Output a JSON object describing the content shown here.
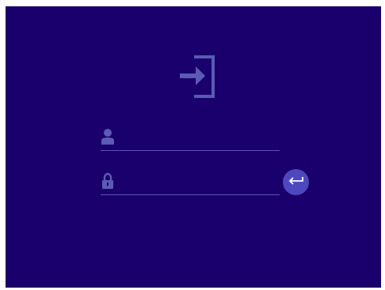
{
  "login": {
    "title_icon": "login-arrow-icon",
    "username": {
      "icon": "user-icon",
      "value": "",
      "placeholder": ""
    },
    "password": {
      "icon": "lock-icon",
      "value": "",
      "placeholder": ""
    },
    "submit_icon": "enter-return-icon"
  },
  "colors": {
    "background": "#19006c",
    "icon": "#5b5ab4",
    "field_line": "#5b55b6",
    "button": "#4d48bd",
    "button_icon": "#ffffff"
  }
}
